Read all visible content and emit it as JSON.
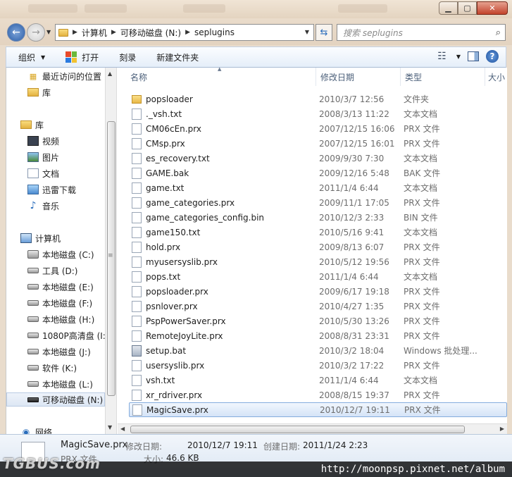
{
  "address": {
    "crumbs": [
      "计算机",
      "可移动磁盘 (N:)",
      "seplugins"
    ]
  },
  "search": {
    "placeholder": "搜索 seplugins"
  },
  "toolbar": {
    "organize": "组织",
    "open": "打开",
    "burn": "刻录",
    "new_folder": "新建文件夹"
  },
  "nav": {
    "favorites_partial": "最近访问的位置",
    "lib_partial": "库",
    "libraries": "库",
    "lib_items": [
      "视频",
      "图片",
      "文档",
      "迅雷下载",
      "音乐"
    ],
    "computer": "计算机",
    "drives": [
      "本地磁盘 (C:)",
      "工具 (D:)",
      "本地磁盘 (E:)",
      "本地磁盘 (F:)",
      "本地磁盘 (H:)",
      "1080P高清盘 (I:)",
      "本地磁盘 (J:)",
      "软件 (K:)",
      "本地磁盘 (L:)",
      "可移动磁盘 (N:)"
    ],
    "network": "网络"
  },
  "columns": {
    "name": "名称",
    "date": "修改日期",
    "type": "类型",
    "size": "大小"
  },
  "files": [
    {
      "name": "popsloader",
      "date": "2010/3/7 12:56",
      "type": "文件夹",
      "kind": "folder"
    },
    {
      "name": "._vsh.txt",
      "date": "2008/3/13 11:22",
      "type": "文本文档",
      "kind": "file"
    },
    {
      "name": "CM06cEn.prx",
      "date": "2007/12/15 16:06",
      "type": "PRX 文件",
      "kind": "file"
    },
    {
      "name": "CMsp.prx",
      "date": "2007/12/15 16:01",
      "type": "PRX 文件",
      "kind": "file"
    },
    {
      "name": "es_recovery.txt",
      "date": "2009/9/30 7:30",
      "type": "文本文档",
      "kind": "file"
    },
    {
      "name": "GAME.bak",
      "date": "2009/12/16 5:48",
      "type": "BAK 文件",
      "kind": "file"
    },
    {
      "name": "game.txt",
      "date": "2011/1/4 6:44",
      "type": "文本文档",
      "kind": "file"
    },
    {
      "name": "game_categories.prx",
      "date": "2009/11/1 17:05",
      "type": "PRX 文件",
      "kind": "file"
    },
    {
      "name": "game_categories_config.bin",
      "date": "2010/12/3 2:33",
      "type": "BIN 文件",
      "kind": "file"
    },
    {
      "name": "game150.txt",
      "date": "2010/5/16 9:41",
      "type": "文本文档",
      "kind": "file"
    },
    {
      "name": "hold.prx",
      "date": "2009/8/13 6:07",
      "type": "PRX 文件",
      "kind": "file"
    },
    {
      "name": "myusersyslib.prx",
      "date": "2010/5/12 19:56",
      "type": "PRX 文件",
      "kind": "file"
    },
    {
      "name": "pops.txt",
      "date": "2011/1/4 6:44",
      "type": "文本文档",
      "kind": "file"
    },
    {
      "name": "popsloader.prx",
      "date": "2009/6/17 19:18",
      "type": "PRX 文件",
      "kind": "file"
    },
    {
      "name": "psnlover.prx",
      "date": "2010/4/27 1:35",
      "type": "PRX 文件",
      "kind": "file"
    },
    {
      "name": "PspPowerSaver.prx",
      "date": "2010/5/30 13:26",
      "type": "PRX 文件",
      "kind": "file"
    },
    {
      "name": "RemoteJoyLite.prx",
      "date": "2008/8/31 23:31",
      "type": "PRX 文件",
      "kind": "file"
    },
    {
      "name": "setup.bat",
      "date": "2010/3/2 18:04",
      "type": "Windows 批处理...",
      "kind": "bat"
    },
    {
      "name": "usersyslib.prx",
      "date": "2010/3/2 17:22",
      "type": "PRX 文件",
      "kind": "file"
    },
    {
      "name": "vsh.txt",
      "date": "2011/1/4 6:44",
      "type": "文本文档",
      "kind": "file"
    },
    {
      "name": "xr_rdriver.prx",
      "date": "2008/8/15 19:37",
      "type": "PRX 文件",
      "kind": "file"
    },
    {
      "name": "MagicSave.prx",
      "date": "2010/12/7 19:11",
      "type": "PRX 文件",
      "kind": "file",
      "selected": true
    }
  ],
  "details": {
    "name": "MagicSave.prx",
    "type": "PRX 文件",
    "modified_label": "修改日期:",
    "modified": "2010/12/7 19:11",
    "created_label": "创建日期:",
    "created": "2011/1/24 2:23",
    "size_label": "大小:",
    "size": "46.6 KB"
  },
  "watermark": {
    "left": "TGBUS.com",
    "url": "http://moonpsp.pixnet.net/album"
  }
}
